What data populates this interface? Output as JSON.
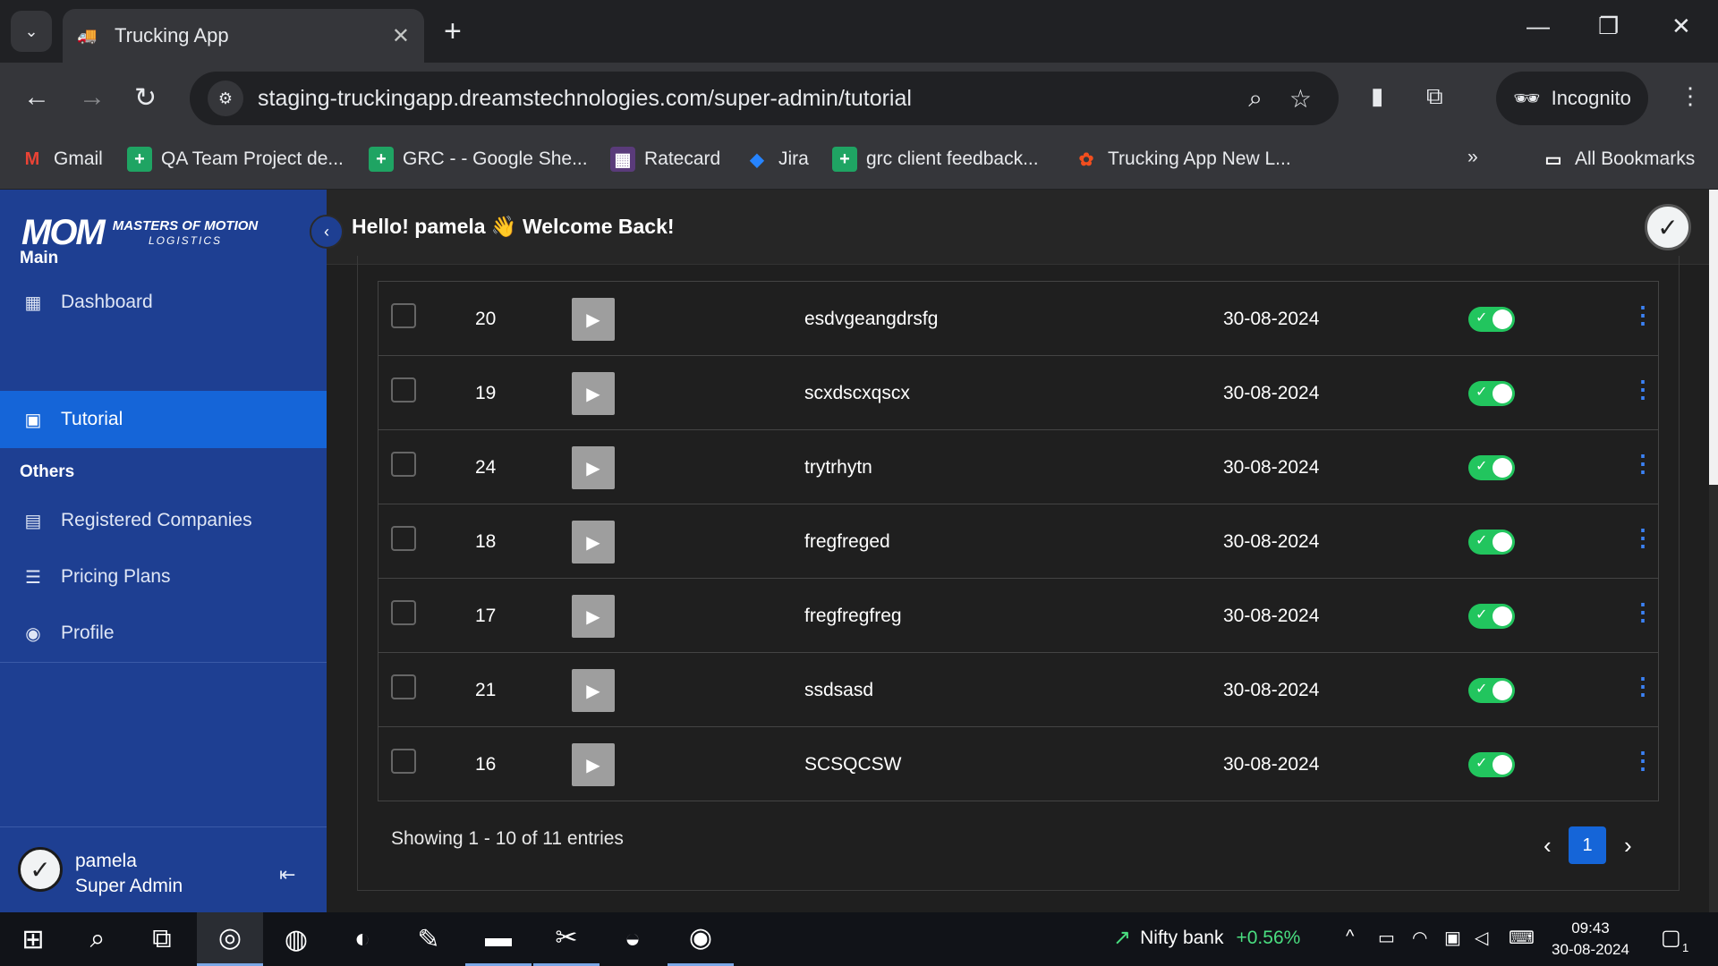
{
  "browser": {
    "tab_title": "Trucking App",
    "url": "staging-truckingapp.dreamstechnologies.com/super-admin/tutorial",
    "profile_label": "Incognito",
    "bookmarks": [
      {
        "label": "Gmail"
      },
      {
        "label": "QA Team Project de..."
      },
      {
        "label": "GRC - - Google She..."
      },
      {
        "label": "Ratecard"
      },
      {
        "label": "Jira"
      },
      {
        "label": "grc client feedback..."
      },
      {
        "label": "Trucking App New L..."
      }
    ],
    "all_bookmarks": "All Bookmarks"
  },
  "sidebar": {
    "logo_text": "MOM",
    "logo_name": "MASTERS OF MOTION",
    "logo_sub": "LOGISTICS",
    "section_main": "Main",
    "section_others": "Others",
    "items": [
      {
        "label": "Dashboard",
        "icon": "dashboard-icon"
      },
      {
        "label": "Tutorial",
        "icon": "video-icon",
        "active": true
      },
      {
        "label": "Registered Companies",
        "icon": "building-icon"
      },
      {
        "label": "Pricing Plans",
        "icon": "list-icon"
      },
      {
        "label": "Profile",
        "icon": "user-circle-icon"
      }
    ],
    "user": {
      "name": "pamela",
      "role": "Super Admin"
    }
  },
  "header": {
    "greeting": "Hello! pamela 👋 Welcome Back!"
  },
  "table": {
    "rows": [
      {
        "id": "20",
        "name": "esdvgeangdrsfg",
        "date": "30-08-2024",
        "active": true
      },
      {
        "id": "19",
        "name": "scxdscxqscx",
        "date": "30-08-2024",
        "active": true
      },
      {
        "id": "24",
        "name": "trytrhytn",
        "date": "30-08-2024",
        "active": true
      },
      {
        "id": "18",
        "name": "fregfreged",
        "date": "30-08-2024",
        "active": true
      },
      {
        "id": "17",
        "name": "fregfregfreg",
        "date": "30-08-2024",
        "active": true
      },
      {
        "id": "21",
        "name": "ssdsasd",
        "date": "30-08-2024",
        "active": true
      },
      {
        "id": "16",
        "name": "SCSQCSW",
        "date": "30-08-2024",
        "active": true
      }
    ]
  },
  "pagination": {
    "summary": "Showing 1 - 10 of 11 entries",
    "current_page": "1"
  },
  "taskbar": {
    "ticker_name": "Nifty bank",
    "ticker_change": "+0.56%",
    "time": "09:43",
    "date": "30-08-2024",
    "notification_count": "1"
  },
  "colors": {
    "sidebar": "#1e3f92",
    "active_nav": "#1565d8",
    "toggle_on": "#22c55e",
    "accent": "#3b82f6"
  }
}
